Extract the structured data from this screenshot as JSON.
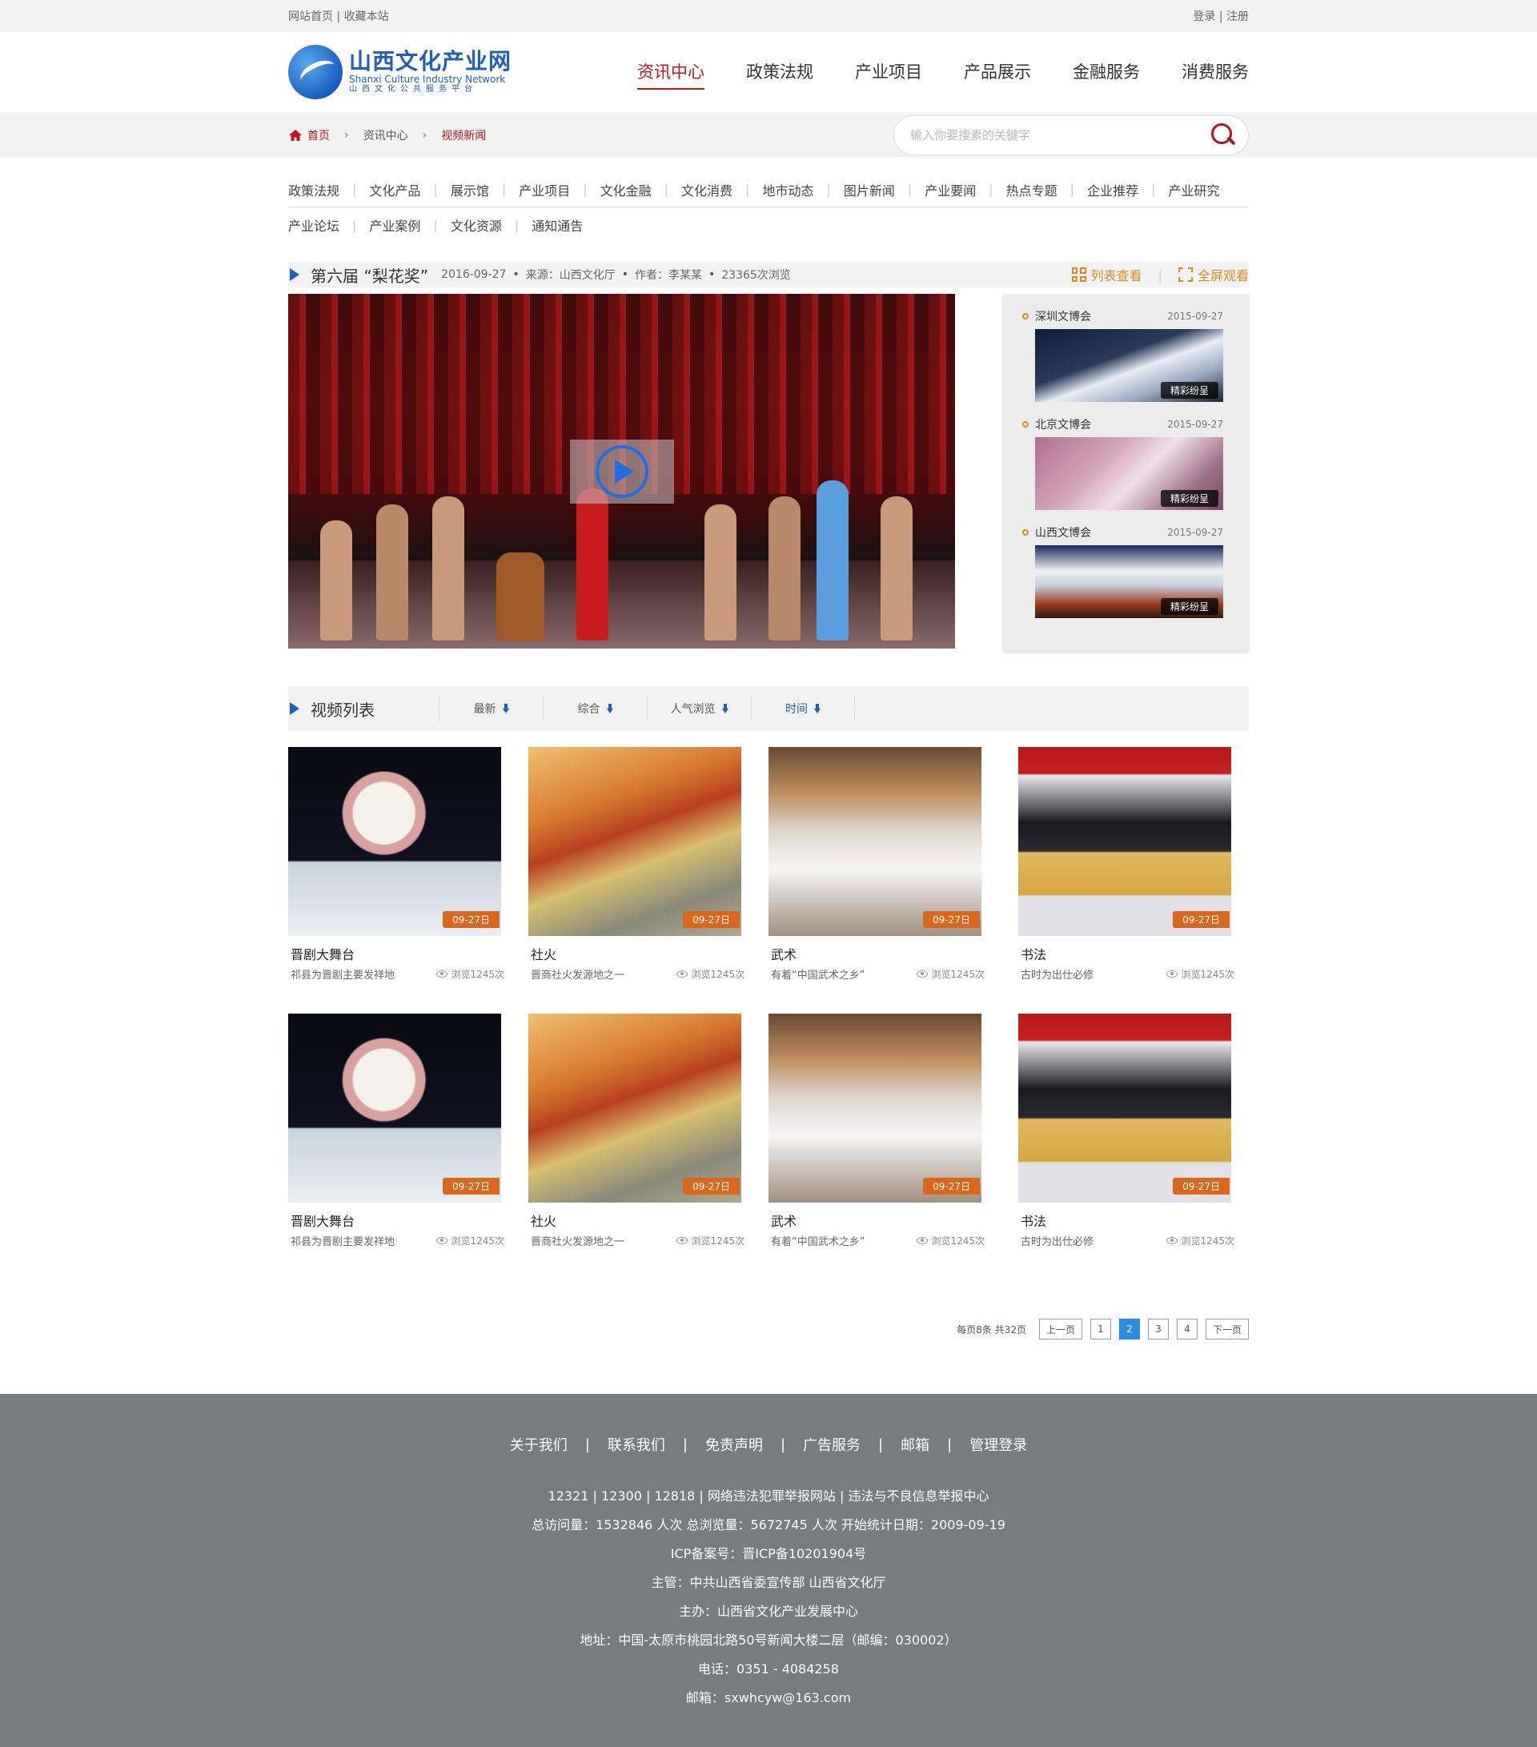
{
  "topbar": {
    "left": [
      "网站首页",
      "收藏本站"
    ],
    "right": [
      "登录",
      "注册"
    ]
  },
  "logo": {
    "cn": "山西文化产业网",
    "en": "Shanxi Culture Industry Network",
    "sub": "山西文化公共服务平台"
  },
  "mainnav": [
    "资讯中心",
    "政策法规",
    "产业项目",
    "产品展示",
    "金融服务",
    "消费服务"
  ],
  "breadcrumb": {
    "home": "首页",
    "mid": "资讯中心",
    "current": "视频新闻"
  },
  "search": {
    "placeholder": "输入你要搜素的关键字"
  },
  "catnav": {
    "row1": [
      "政策法规",
      "文化产品",
      "展示馆",
      "产业项目",
      "文化金融",
      "文化消费",
      "地市动态",
      "图片新闻",
      "产业要闻",
      "热点专题",
      "企业推荐",
      "产业研究"
    ],
    "row2": [
      "产业论坛",
      "产业案例",
      "文化资源",
      "通知通告"
    ]
  },
  "featured": {
    "title": "第六届 “梨花奖”",
    "date": "2016-09-27",
    "source": "来源：山西文化厅",
    "author": "作者：李某某",
    "views": "23365次浏览",
    "list_view": "列表查看",
    "fullscreen": "全屏观看"
  },
  "side_items": [
    {
      "title": "深圳文博会",
      "date": "2015-09-27",
      "badge": "精彩纷呈"
    },
    {
      "title": "北京文博会",
      "date": "2015-09-27",
      "badge": "精彩纷呈"
    },
    {
      "title": "山西文博会",
      "date": "2015-09-27",
      "badge": "精彩纷呈"
    }
  ],
  "video_list": {
    "title": "视频列表",
    "sorts": [
      "最新",
      "综合",
      "人气浏览",
      "时间"
    ]
  },
  "videos": [
    {
      "title": "晋剧大舞台",
      "desc": "祁县为晋剧主要发祥地",
      "date": "09-27日",
      "views": "浏览1245次"
    },
    {
      "title": "社火",
      "desc": "晋商社火发源地之一",
      "date": "09-27日",
      "views": "浏览1245次"
    },
    {
      "title": "武术",
      "desc": "有着“中国武术之乡”",
      "date": "09-27日",
      "views": "浏览1245次"
    },
    {
      "title": "书法",
      "desc": "古时为出仕必修",
      "date": "09-27日",
      "views": "浏览1245次"
    },
    {
      "title": "晋剧大舞台",
      "desc": "祁县为晋剧主要发祥地",
      "date": "09-27日",
      "views": "浏览1245次"
    },
    {
      "title": "社火",
      "desc": "晋商社火发源地之一",
      "date": "09-27日",
      "views": "浏览1245次"
    },
    {
      "title": "武术",
      "desc": "有着“中国武术之乡”",
      "date": "09-27日",
      "views": "浏览1245次"
    },
    {
      "title": "书法",
      "desc": "古时为出仕必修",
      "date": "09-27日",
      "views": "浏览1245次"
    }
  ],
  "pager": {
    "info": "每页8条 共32页",
    "prev": "上一页",
    "pages": [
      "1",
      "2",
      "3",
      "4"
    ],
    "current": "2",
    "next": "下一页"
  },
  "footer": {
    "links": [
      "关于我们",
      "联系我们",
      "免责声明",
      "广告服务",
      "邮箱",
      "管理登录"
    ],
    "lines": [
      "12321 | 12300 | 12818 | 网络违法犯罪举报网站 | 违法与不良信息举报中心",
      "总访问量：1532846 人次  总浏览量：5672745 人次  开始统计日期：2009-09-19",
      "ICP备案号：晋ICP备10201904号",
      "主管：中共山西省委宣传部 山西省文化厅",
      "主办：山西省文化产业发展中心",
      "地址：中国-太原市桃园北路50号新闻大楼二层（邮编：030002）",
      "电话：0351 - 4084258",
      "邮箱：sxwhcyw@163.com"
    ]
  },
  "colors": {
    "accent_red": "#c0161b",
    "accent_blue": "#1f5fb8",
    "accent_orange": "#e08a1f",
    "footer_bg": "#7a7b7d"
  }
}
